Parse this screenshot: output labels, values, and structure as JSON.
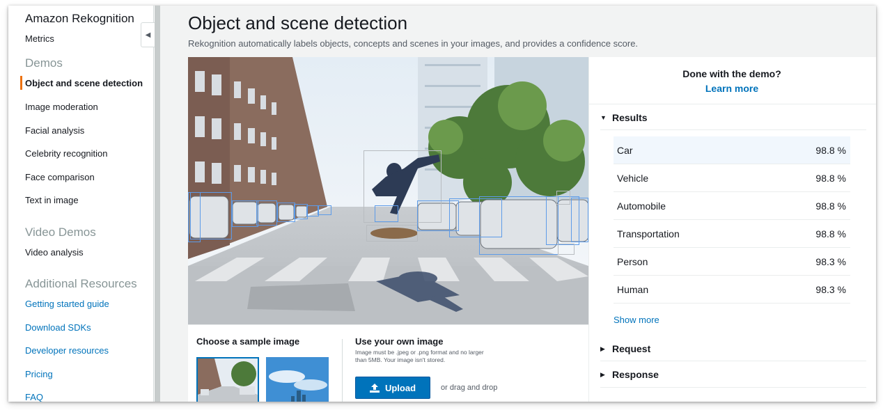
{
  "sidebar": {
    "title": "Amazon Rekognition",
    "metrics": "Metrics",
    "demos_heading": "Demos",
    "demos": [
      {
        "label": "Object and scene detection",
        "active": true
      },
      {
        "label": "Image moderation"
      },
      {
        "label": "Facial analysis"
      },
      {
        "label": "Celebrity recognition"
      },
      {
        "label": "Face comparison"
      },
      {
        "label": "Text in image"
      }
    ],
    "video_heading": "Video Demos",
    "video_items": [
      {
        "label": "Video analysis"
      }
    ],
    "resources_heading": "Additional Resources",
    "resources": [
      {
        "label": "Getting started guide"
      },
      {
        "label": "Download SDKs"
      },
      {
        "label": "Developer resources"
      },
      {
        "label": "Pricing"
      },
      {
        "label": "FAQ"
      }
    ],
    "collapse_icon": "chevron-left-icon"
  },
  "main": {
    "title": "Object and scene detection",
    "description": "Rekognition automatically labels objects, concepts and scenes in your images, and provides a confidence score."
  },
  "samples": {
    "choose_label": "Choose a sample image",
    "own_label": "Use your own image",
    "own_hint": "Image must be .jpeg or .png format and no larger than 5MB. Your image isn't stored.",
    "upload_label": "Upload",
    "upload_icon": "upload-icon",
    "drag_text": "or drag and drop"
  },
  "results_panel": {
    "done_text": "Done with the demo?",
    "learn_more": "Learn more",
    "results_heading": "Results",
    "results": [
      {
        "label": "Car",
        "confidence": "98.8 %"
      },
      {
        "label": "Vehicle",
        "confidence": "98.8 %"
      },
      {
        "label": "Automobile",
        "confidence": "98.8 %"
      },
      {
        "label": "Transportation",
        "confidence": "98.8 %"
      },
      {
        "label": "Person",
        "confidence": "98.3 %"
      },
      {
        "label": "Human",
        "confidence": "98.3 %"
      }
    ],
    "show_more": "Show more",
    "request_heading": "Request",
    "response_heading": "Response"
  },
  "colors": {
    "accent_link": "#0073bb",
    "active_indicator": "#ec7211",
    "bounding_box": "#5d9be8",
    "highlight_row": "#f1f7fd"
  }
}
